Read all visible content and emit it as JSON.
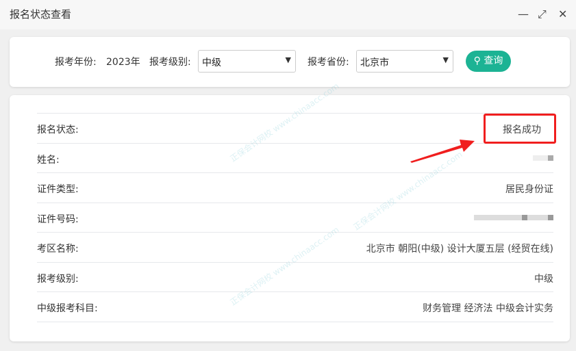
{
  "window": {
    "title": "报名状态查看",
    "minimize": "—",
    "maximize": "⤢",
    "close": "✕"
  },
  "filter": {
    "year_label": "报考年份:",
    "year_value": "2023年",
    "level_label": "报考级别:",
    "level_value": "中级",
    "province_label": "报考省份:",
    "province_value": "北京市",
    "query_label": "查询"
  },
  "rows": [
    {
      "label": "报名状态:",
      "value": "报名成功"
    },
    {
      "label": "姓名:",
      "value": ""
    },
    {
      "label": "证件类型:",
      "value": "居民身份证"
    },
    {
      "label": "证件号码:",
      "value": ""
    },
    {
      "label": "考区名称:",
      "value": "北京市 朝阳(中级) 设计大厦五层 (经贸在线)"
    },
    {
      "label": "报考级别:",
      "value": "中级"
    },
    {
      "label": "中级报考科目:",
      "value": "财务管理 经济法 中级会计实务"
    }
  ],
  "watermark": "正保会计网校 www.chinaacc.com",
  "colors": {
    "accent": "#1cb394",
    "highlight": "#f01e1e"
  }
}
